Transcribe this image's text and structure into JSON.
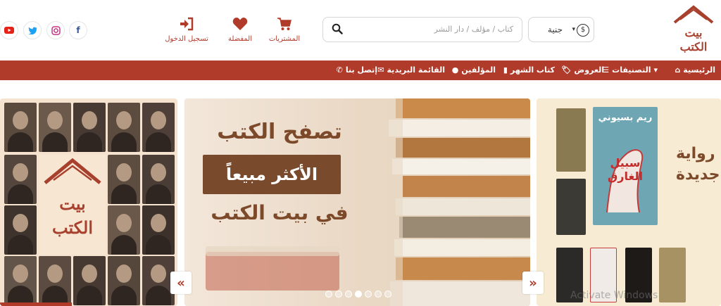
{
  "header": {
    "logo_text": "بيت الكتب",
    "search": {
      "placeholder": "كتاب / مؤلف / دار النشر"
    },
    "currency": {
      "selected": "جنية",
      "symbol": "$"
    },
    "cart_label": "المشتريات",
    "favorites_label": "المفضلة",
    "login_label": "تسجيل الدخول",
    "social": [
      {
        "name": "facebook",
        "glyph": "f",
        "color": "#3b5998"
      },
      {
        "name": "instagram",
        "glyph": "◎",
        "color": "#c13584"
      },
      {
        "name": "twitter",
        "glyph": "🐦",
        "color": "#1da1f2"
      },
      {
        "name": "youtube",
        "glyph": "▶",
        "color": "#e62117"
      }
    ]
  },
  "nav": {
    "items": [
      {
        "label": "الرئيسية",
        "icon": "home-icon"
      },
      {
        "label": "التصنيفات",
        "icon": "list-icon"
      },
      {
        "label": "العروض",
        "icon": "tag-icon"
      },
      {
        "label": "كتاب الشهر",
        "icon": "book-icon"
      },
      {
        "label": "المؤلفين",
        "icon": "user-icon"
      },
      {
        "label": "القائمة البريدية",
        "icon": "envelope-icon"
      },
      {
        "label": "إتصل بنا",
        "icon": "phone-icon"
      }
    ]
  },
  "slider": {
    "center": {
      "line1": "تصفح الكتب",
      "line2": "الأكثر مبيعاً",
      "line3": "في بيت الكتب"
    },
    "right": {
      "label": "رواية جديدة",
      "book_title": "ريم بسيوني",
      "book_subtitle": "سبيل الغارق"
    },
    "left": {
      "logo_text": "بيت الكتب"
    },
    "dots_count": 7,
    "active_dot": 3
  },
  "watermark": "Activate Windows",
  "colors": {
    "brand": "#b03b2a",
    "cream": "#f6e3cf"
  }
}
